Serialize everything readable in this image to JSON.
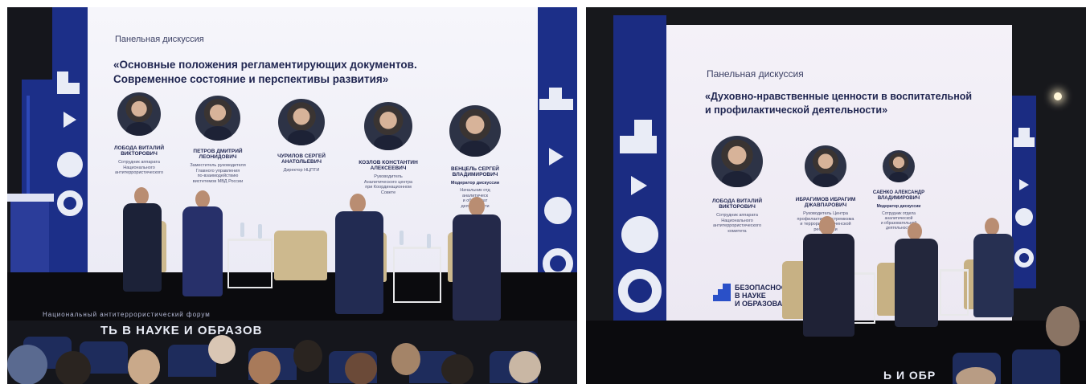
{
  "left_photo": {
    "screen": {
      "label": "Панельная дискуссия",
      "title_line1": "«Основные положения регламентирующих документов.",
      "title_line2": "Современное состояние и перспективы развития»"
    },
    "speakers": [
      {
        "name1": "ЛОБОДА ВИТАЛИЙ",
        "name2": "ВИКТОРОВИЧ",
        "role1": "Сотрудник аппарата",
        "role2": "Национального",
        "role3": "антитеррористического"
      },
      {
        "name1": "ПЕТРОВ ДМИТРИЙ",
        "name2": "ЛЕОНИДОВИЧ",
        "role1": "Заместитель руководителя",
        "role2": "Главного управления",
        "role3": "по-взаимодействию",
        "role4": "вистетемов МВД России"
      },
      {
        "name1": "ЧУРИЛОВ СЕРГЕЙ",
        "name2": "АНАТОЛЬЕВИЧ",
        "role1": "Директор НЦПТИ"
      },
      {
        "name1": "КОЗЛОВ КОНСТАНТИН",
        "name2": "АЛЕКСЕЕВИЧ",
        "role1": "Руководитель",
        "role2": "Аналитического центра",
        "role3": "при Координационном",
        "role4": "Совете"
      },
      {
        "name1": "ВЕНЦЕЛЬ СЕРГЕЙ",
        "name2": "ВЛАДИМИРОВИЧ",
        "moderator": "Модератор дискуссии",
        "role1": "Начальник отд",
        "role2": "аналитическ",
        "role3": "и образоват",
        "role4": "деятельности"
      }
    ],
    "bottom_text_small": "Национальный антитеррористический форум",
    "bottom_text_large": "ТЬ В НАУКЕ И ОБРАЗОВ"
  },
  "right_photo": {
    "screen": {
      "label": "Панельная дискуссия",
      "title_line1": "«Духовно-нравственные ценности в воспитательной",
      "title_line2": "и профилактической деятельности»"
    },
    "speakers": [
      {
        "name1": "ЛОБОДА ВИТАЛИЙ",
        "name2": "ВИКТОРОВИЧ",
        "role1": "Сотрудник аппарата",
        "role2": "Национального",
        "role3": "антитеррористического",
        "role4": "комитета"
      },
      {
        "name1": "ИБРАГИМОВ ИБРАГИМ",
        "name2": "ДЖАВПАРОВИЧ",
        "role1": "Руководитель Центра",
        "role2": "профилактики экстремизма",
        "role3": "и терроризма Чеченской",
        "role4": "республики"
      },
      {
        "name1": "САЕНКО АЛЕКСАНДР",
        "name2": "ВЛАДИМИРОВИЧ",
        "moderator": "Модератор дискуссии",
        "role1": "Сотрудник отдела",
        "role2": "аналитической",
        "role3": "и образовательной",
        "role4": "деятельности"
      }
    ],
    "logo": {
      "line1": "БЕЗОПАСНОСТЬ",
      "line2": "В НАУКЕ",
      "line3": "И ОБРАЗОВАНИ"
    },
    "bottom_text_large": "Ь И ОБР"
  },
  "colors": {
    "led_blue": "#1c2f88",
    "screen_bg": "#f2f2f8",
    "title_navy": "#1f2550",
    "chair_beige": "#cdb98e"
  }
}
